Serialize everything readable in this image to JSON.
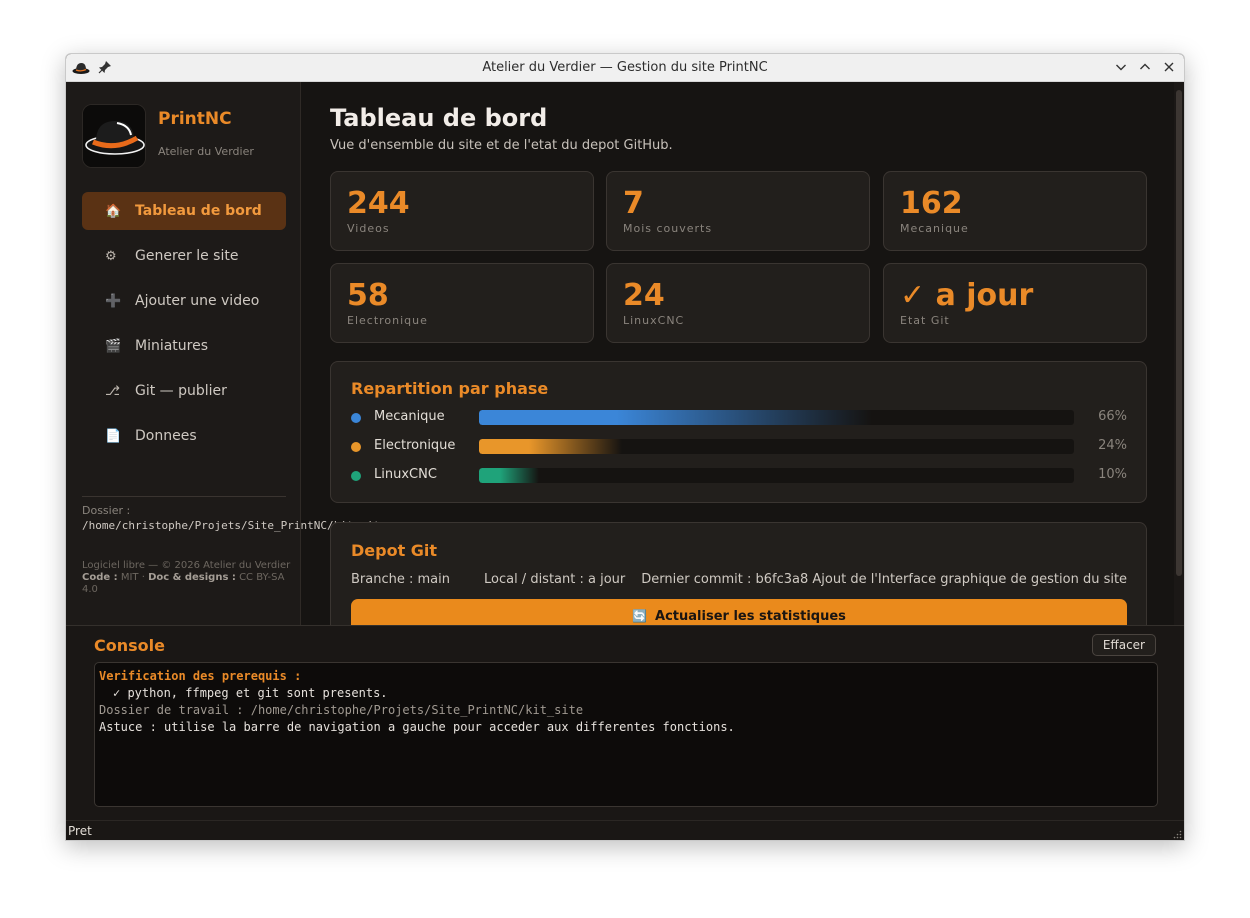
{
  "window": {
    "title": "Atelier du Verdier — Gestion du site PrintNC"
  },
  "sidebar": {
    "brand": "PrintNC",
    "brand_sub": "Atelier du Verdier",
    "items": [
      {
        "icon": "home-icon",
        "glyph": "🏠",
        "label": "Tableau de bord",
        "active": true
      },
      {
        "icon": "gear-icon",
        "glyph": "⚙",
        "label": "Generer le site"
      },
      {
        "icon": "plus-icon",
        "glyph": "➕",
        "label": "Ajouter une video"
      },
      {
        "icon": "clapperboard-icon",
        "glyph": "🎬",
        "label": "Miniatures"
      },
      {
        "icon": "git-branch-icon",
        "glyph": "⎇",
        "label": "Git — publier"
      },
      {
        "icon": "document-icon",
        "glyph": "📄",
        "label": "Donnees"
      }
    ],
    "folder_label": "Dossier :",
    "folder_path": "/home/christophe/Projets/Site_PrintNC/kit_site",
    "license_line1": "Logiciel libre — © 2026 Atelier du Verdier",
    "license_code_label": "Code :",
    "license_code_value": "MIT",
    "license_sep": "·",
    "license_doc_label": "Doc & designs :",
    "license_doc_value": "CC BY-SA 4.0"
  },
  "main": {
    "title": "Tableau de bord",
    "subtitle": "Vue d'ensemble du site et de l'etat du depot GitHub.",
    "stats": [
      {
        "value": "244",
        "label": "Videos"
      },
      {
        "value": "7",
        "label": "Mois couverts"
      },
      {
        "value": "162",
        "label": "Mecanique"
      },
      {
        "value": "58",
        "label": "Electronique"
      },
      {
        "value": "24",
        "label": "LinuxCNC"
      },
      {
        "value": "✓ a jour",
        "label": "Etat Git"
      }
    ],
    "phases": {
      "title": "Repartition par phase",
      "rows": [
        {
          "name": "Mecanique",
          "percent": 66,
          "pct_label": "66%",
          "color": "#3b86d8"
        },
        {
          "name": "Electronique",
          "percent": 24,
          "pct_label": "24%",
          "color": "#e8962a"
        },
        {
          "name": "LinuxCNC",
          "percent": 10,
          "pct_label": "10%",
          "color": "#1fa37a"
        }
      ]
    },
    "git": {
      "title": "Depot Git",
      "branch": "Branche : main",
      "sync": "Local / distant : a jour",
      "last_commit": "Dernier commit : b6fc3a8 Ajout de l'Interface graphique de gestion du site",
      "refresh_label": "Actualiser les statistiques",
      "refresh_glyph": "🔄"
    }
  },
  "console": {
    "title": "Console",
    "clear_label": "Effacer",
    "lines": [
      "Verification des prerequis :",
      "✓ python, ffmpeg et git sont presents.",
      "Dossier de travail : /home/christophe/Projets/Site_PrintNC/kit_site",
      "Astuce : utilise la barre de navigation a gauche pour acceder aux differentes fonctions."
    ]
  },
  "status": {
    "text": "Pret"
  },
  "colors": {
    "accent": "#ea8a28",
    "background": "#161412",
    "panel": "#221f1c"
  }
}
